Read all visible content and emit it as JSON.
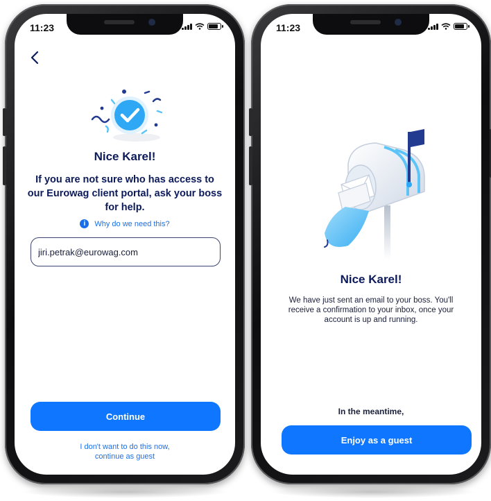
{
  "colors": {
    "primary": "#0f76ff",
    "title": "#0c1a5a",
    "link": "#1a6fe8",
    "checkmark": "#2ea8f5"
  },
  "left_screen": {
    "status_time": "11:23",
    "back_icon": "chevron-left-icon",
    "illustration_icon": "checkmark-confetti-icon",
    "title": "Nice Karel!",
    "message": "If you are not sure who has access to our Eurowag client portal, ask your boss for help.",
    "info_link": "Why do we need this?",
    "email_value": "jiri.petrak@eurowag.com",
    "continue_label": "Continue",
    "skip_line1": "I don't want to do this now,",
    "skip_line2": "continue as guest"
  },
  "right_screen": {
    "status_time": "11:23",
    "illustration_icon": "mailbox-icon",
    "title": "Nice Karel!",
    "message": "We have just sent an email to your boss. You'll receive a confirmation to your inbox, once your account is up and running.",
    "meantime": "In the meantime,",
    "guest_label": "Enjoy as a guest"
  }
}
